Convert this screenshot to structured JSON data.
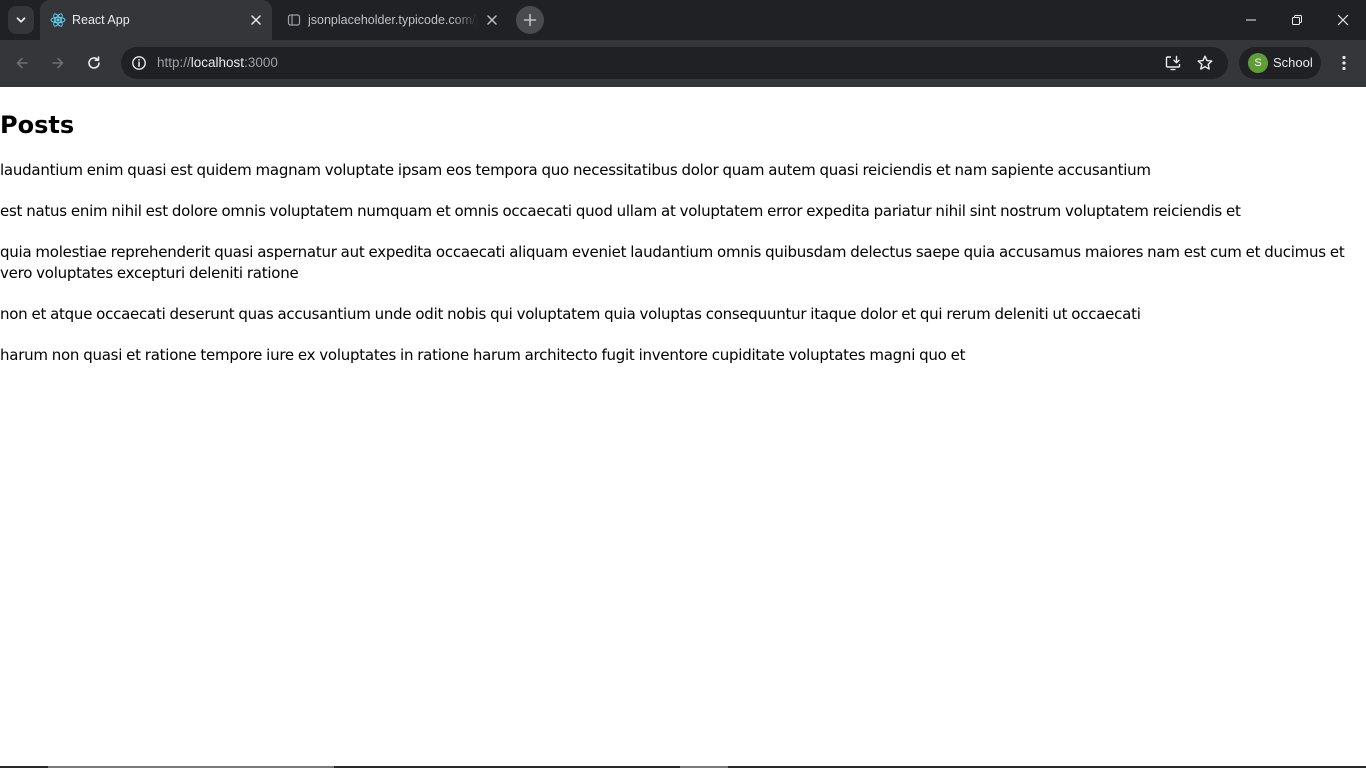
{
  "browser": {
    "tabs": [
      {
        "title": "React App",
        "active": true,
        "icon": "react-icon"
      },
      {
        "title": "jsonplaceholder.typicode.com/posts",
        "active": false,
        "icon": "page-icon"
      }
    ],
    "url": {
      "scheme": "http://",
      "host": "localhost",
      "port": ":3000"
    },
    "profile": {
      "initial": "S",
      "name": "School",
      "color": "#5f9e36"
    }
  },
  "page": {
    "heading": "Posts",
    "posts": [
      "laudantium enim quasi est quidem magnam voluptate ipsam eos tempora quo necessitatibus dolor quam autem quasi reiciendis et nam sapiente accusantium",
      "est natus enim nihil est dolore omnis voluptatem numquam et omnis occaecati quod ullam at voluptatem error expedita pariatur nihil sint nostrum voluptatem reiciendis et",
      "quia molestiae reprehenderit quasi aspernatur aut expedita occaecati aliquam eveniet laudantium omnis quibusdam delectus saepe quia accusamus maiores nam est cum et ducimus et vero voluptates excepturi deleniti ratione",
      "non et atque occaecati deserunt quas accusantium unde odit nobis qui voluptatem quia voluptas consequuntur itaque dolor et qui rerum deleniti ut occaecati",
      "harum non quasi et ratione tempore iure ex voluptates in ratione harum architecto fugit inventore cupiditate voluptates magni quo et"
    ]
  }
}
